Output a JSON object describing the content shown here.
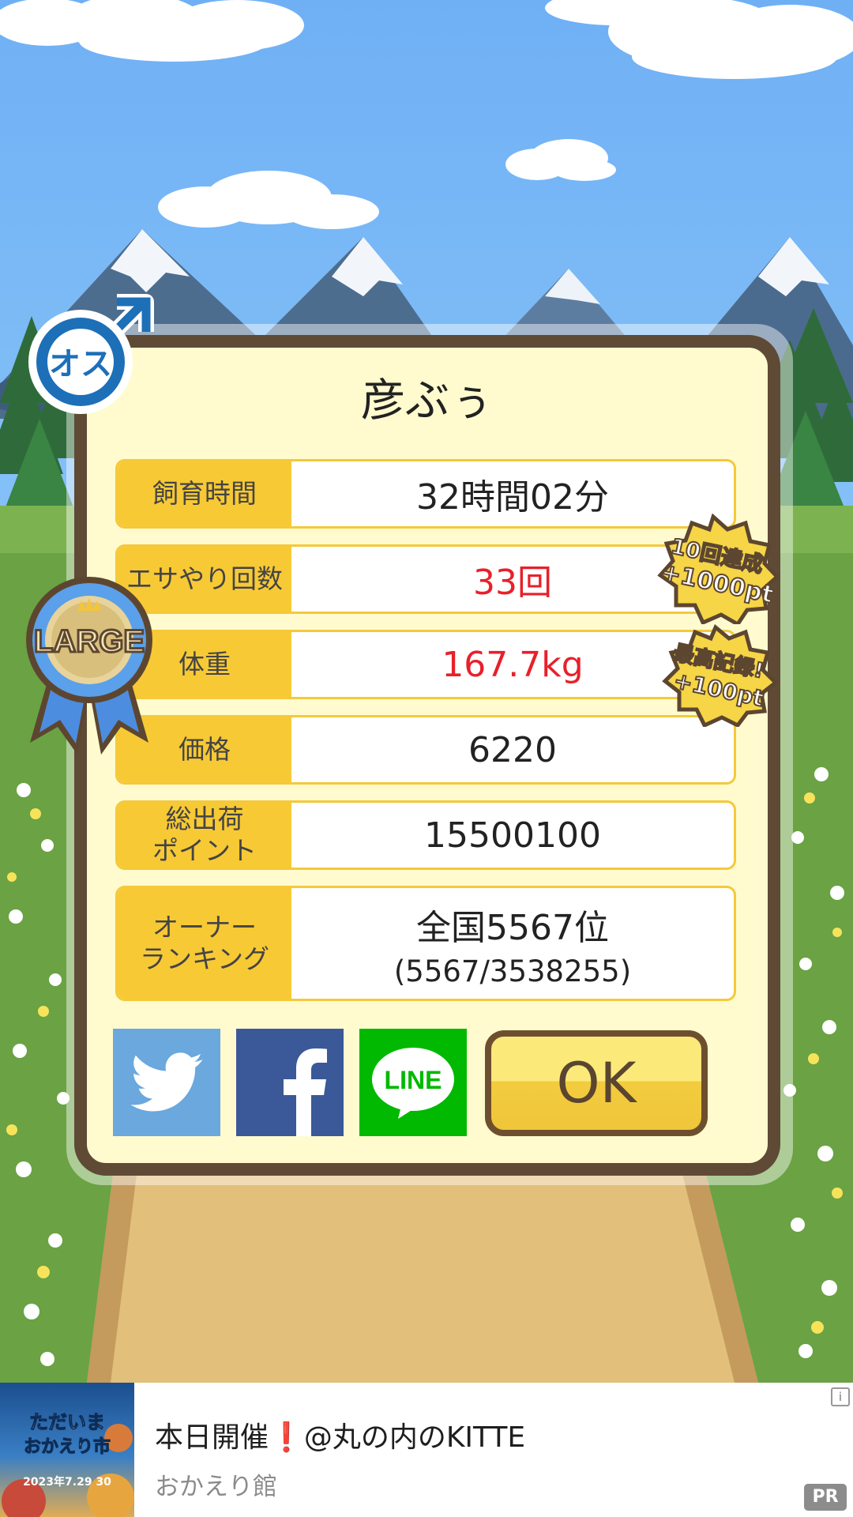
{
  "pig": {
    "gender_label": "オス",
    "size_label": "LARGE",
    "name": "彦ぶぅ"
  },
  "stats": {
    "rearing_time": {
      "label": "飼育時間",
      "value": "32時間02分"
    },
    "feedings": {
      "label": "エサやり回数",
      "value": "33回"
    },
    "weight": {
      "label": "体重",
      "value": "167.7kg"
    },
    "price": {
      "label": "価格",
      "value": "6220"
    },
    "shipping_points": {
      "label_line1": "総出荷",
      "label_line2": "ポイント",
      "value": "15500100"
    },
    "owner_ranking": {
      "label_line1": "オーナー",
      "label_line2": "ランキング",
      "value_line1": "全国5567位",
      "value_line2": "(5567/3538255)"
    }
  },
  "bonus_badges": {
    "combo": {
      "line1": "10回達成",
      "line2": "+1000pt"
    },
    "record": {
      "line1": "最高記録!",
      "line2": "+100pt"
    }
  },
  "share": {
    "line_label": "LINE"
  },
  "ok_label": "OK",
  "ad": {
    "headline": "本日開催❗@丸の内のKITTE",
    "sub": "おかえり館",
    "pr_label": "PR",
    "info_label": "i",
    "image_title_line1": "ただいま",
    "image_title_line2": "おかえり市",
    "image_date": "2023年7.29 30"
  },
  "colors": {
    "value_highlight": "#e8202a",
    "label_bg": "#f7c934",
    "card_border": "#5f4a36",
    "twitter": "#6aa8dd",
    "facebook": "#3b5998",
    "line": "#00b900"
  }
}
